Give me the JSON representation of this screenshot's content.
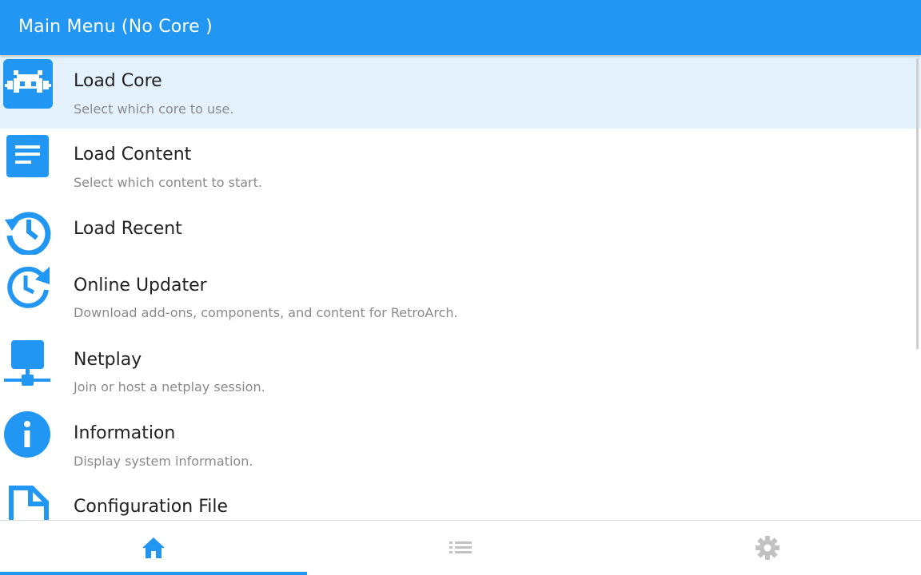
{
  "header": {
    "title": "Main Menu (No Core )"
  },
  "colors": {
    "accent": "#2196f3",
    "selected_bg": "#e3f2fd",
    "inactive_tab": "#c2c2c2"
  },
  "menu": {
    "items": [
      {
        "icon": "retroarch-invader-icon",
        "title": "Load Core",
        "sublabel": "Select which core to use.",
        "selected": true
      },
      {
        "icon": "document-lines-icon",
        "title": "Load Content",
        "sublabel": "Select which content to start."
      },
      {
        "icon": "history-icon",
        "title": "Load Recent",
        "sublabel": ""
      },
      {
        "icon": "update-clock-icon",
        "title": "Online Updater",
        "sublabel": "Download add-ons, components, and content for RetroArch."
      },
      {
        "icon": "network-icon",
        "title": "Netplay",
        "sublabel": "Join or host a netplay session."
      },
      {
        "icon": "info-icon",
        "title": "Information",
        "sublabel": "Display system information."
      },
      {
        "icon": "file-icon",
        "title": "Configuration File",
        "sublabel": ""
      }
    ]
  },
  "tabs": [
    {
      "icon": "home-icon",
      "active": true
    },
    {
      "icon": "list-icon",
      "active": false
    },
    {
      "icon": "gear-icon",
      "active": false
    }
  ]
}
